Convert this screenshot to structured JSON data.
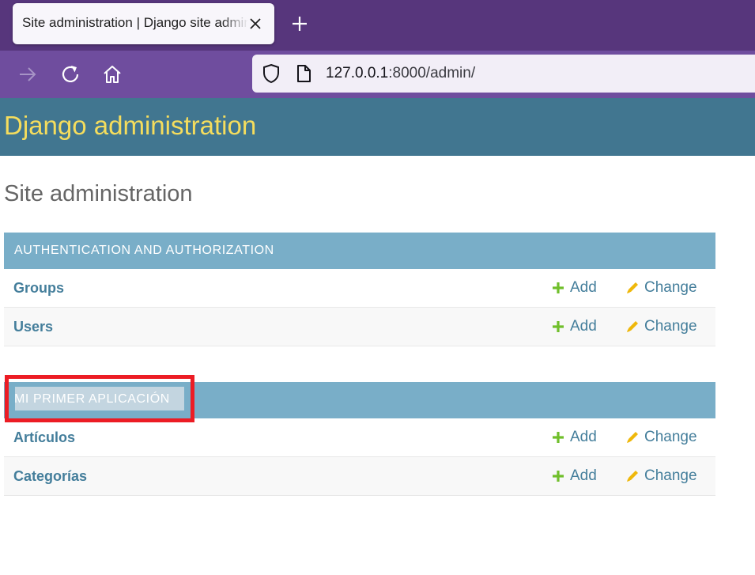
{
  "browser": {
    "tab_title": "Site administration | Django site admin",
    "url_host": "127.0.0.1",
    "url_rest": ":8000/admin/"
  },
  "admin": {
    "branding": "Django administration",
    "page_title": "Site administration",
    "add_label": "Add",
    "change_label": "Change",
    "modules": [
      {
        "caption": "AUTHENTICATION AND AUTHORIZATION",
        "models": [
          {
            "name": "Groups"
          },
          {
            "name": "Users"
          }
        ]
      },
      {
        "caption": "MI PRIMER APLICACIÓN",
        "models": [
          {
            "name": "Artículos"
          },
          {
            "name": "Categorías"
          }
        ]
      }
    ]
  },
  "colors": {
    "tabbar": "#57367c",
    "navbar": "#6f4d9e",
    "header": "#417690",
    "branding": "#f5dd5d",
    "caption": "#79aec8",
    "link": "#447e9b",
    "add_icon": "#70bf2b",
    "change_icon": "#efb80b",
    "highlight": "#ec1c24"
  },
  "icons": {
    "forward": "arrow-right-icon",
    "reload": "reload-icon",
    "home": "home-icon",
    "shield": "shield-icon",
    "page": "page-icon",
    "close": "close-icon",
    "new_tab": "plus-icon",
    "add": "plus-icon",
    "change": "pencil-icon"
  }
}
